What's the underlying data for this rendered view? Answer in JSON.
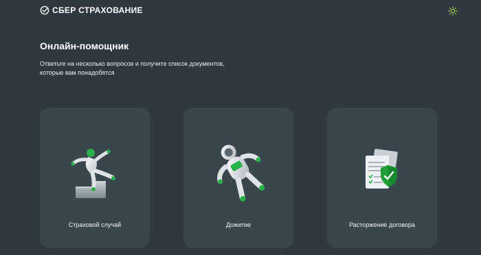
{
  "header": {
    "brand": "СБЕР СТРАХОВАНИЕ",
    "theme_icon": "sun-icon"
  },
  "main": {
    "title": "Онлайн-помощник",
    "description": "Ответьте на несколько вопросов и получите список документов, которые вам понадобятся"
  },
  "cards": [
    {
      "label": "Страховой случай",
      "icon": "falling-figure-icon"
    },
    {
      "label": "Дожитие",
      "icon": "astronaut-icon"
    },
    {
      "label": "Расторжение договора",
      "icon": "documents-shield-icon"
    }
  ],
  "colors": {
    "background": "#2f393f",
    "card": "#3a464d",
    "accent": "#21a038",
    "sun": "#a4d65e"
  }
}
